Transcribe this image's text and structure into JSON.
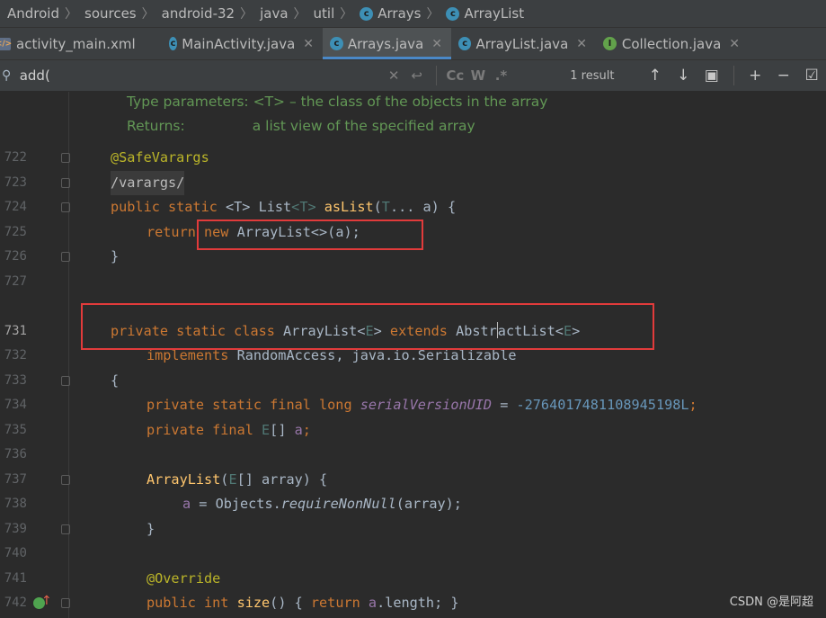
{
  "breadcrumb": [
    "Android",
    "sources",
    "android-32",
    "java",
    "util",
    "Arrays",
    "ArrayList"
  ],
  "tabs": [
    {
      "label": "activity_main.xml"
    },
    {
      "label": "MainActivity.java"
    },
    {
      "label": "Arrays.java"
    },
    {
      "label": "ArrayList.java"
    },
    {
      "label": "Collection.java"
    }
  ],
  "search": {
    "query": "add(",
    "result": "1 result",
    "cc": "Cc",
    "w": "W",
    "regex": ".*"
  },
  "doc": {
    "type_params_label": "Type parameters:",
    "type_params_text": "<T> – the class of the objects in the array",
    "returns_label": "Returns:",
    "returns_text": "a list view of the specified array"
  },
  "line_numbers": [
    "722",
    "723",
    "724",
    "725",
    "726",
    "727",
    "731",
    "732",
    "733",
    "734",
    "735",
    "736",
    "737",
    "738",
    "739",
    "740",
    "741",
    "742"
  ],
  "code": {
    "l722": "@SafeVarargs",
    "l723": "/varargs/",
    "l724": [
      "public static ",
      "<T>",
      " List",
      "<T>",
      " ",
      "asList",
      "(",
      "T",
      "... a) {"
    ],
    "l725": [
      "return ",
      "new ",
      "ArrayList<>(a);"
    ],
    "l726": "}",
    "l731": [
      "private static class ",
      "ArrayList<",
      "E",
      "> ",
      "extends ",
      "Abstr",
      "actList<",
      "E",
      ">"
    ],
    "l732": [
      "implements ",
      "RandomAccess, java.io.Serializable"
    ],
    "l733": "{",
    "l734": [
      "private static final long ",
      "serialVersionUID",
      " = ",
      "-2764017481108945198L",
      ";"
    ],
    "l735": [
      "private final ",
      "E",
      "[] ",
      "a",
      ";"
    ],
    "l737": [
      "ArrayList",
      "(",
      "E",
      "[] array) {"
    ],
    "l738": [
      "a",
      " = Objects.",
      "requireNonNull",
      "(array);"
    ],
    "l739": "}",
    "l741": "@Override",
    "l742": [
      "public int ",
      "size",
      "() { ",
      "return ",
      "a",
      ".length; }"
    ]
  },
  "watermark": "CSDN @是阿超",
  "colors": {
    "keyword": "#cc7832",
    "annotation": "#bbb529",
    "highlight_box": "#e13b3b",
    "doc_comment": "#629755"
  }
}
